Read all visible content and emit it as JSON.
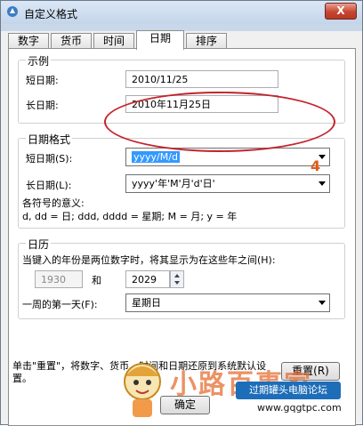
{
  "window": {
    "title": "自定义格式",
    "close_label": "X"
  },
  "tabs": [
    "数字",
    "货币",
    "时间",
    "日期",
    "排序"
  ],
  "example": {
    "title": "示例",
    "short_label": "短日期:",
    "short_value": "2010/11/25",
    "long_label": "长日期:",
    "long_value": "2010年11月25日"
  },
  "date_format": {
    "title": "日期格式",
    "short_label": "短日期(S):",
    "short_value": "yyyy/M/d",
    "long_label": "长日期(L):",
    "long_value": "yyyy'年'M'月'd'日'",
    "symbols_label": "各符号的意义:",
    "symbols_text": "d, dd = 日;  ddd, dddd = 星期;  M = 月;  y = 年"
  },
  "annotation_number": "4",
  "calendar": {
    "title": "日历",
    "two_digit_text": "当键入的年份是两位数字时，将其显示为在这些年之间(H):",
    "year_from": "1930",
    "and_label": "和",
    "year_to": "2029",
    "first_day_label": "一周的第一天(F):",
    "first_day_value": "星期日"
  },
  "footer": {
    "reset_text": "单击\"重置\"，将数字、货币、时间和日期还原到系统默认设置。",
    "reset_button": "重置(R)",
    "ok_button": "确定"
  },
  "watermark": {
    "text": "小路百事家",
    "badge": "过期罐头电脑论坛",
    "url": "www.gqgtpc.com"
  },
  "colors": {
    "annotation": "#c4232d",
    "selection": "#3399ff"
  }
}
